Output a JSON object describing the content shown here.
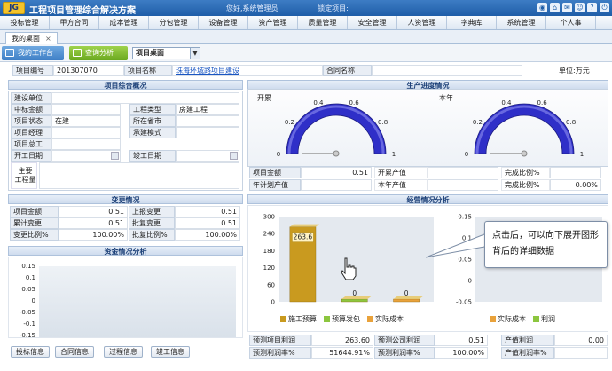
{
  "app": {
    "logo": "JG",
    "title": "工程项目管理综合解决方案",
    "user": "您好,系统管理员",
    "locked_project": "锁定项目:"
  },
  "top_icons": [
    "lock-icon",
    "home-icon",
    "mail-icon",
    "user-icon",
    "help-icon",
    "power-icon"
  ],
  "menu": [
    "投标管理",
    "甲方合同",
    "成本管理",
    "分包管理",
    "设备管理",
    "资产管理",
    "质量管理",
    "安全管理",
    "人资管理",
    "字典库",
    "系统管理",
    "个人事"
  ],
  "tab": {
    "label": "我的桌面",
    "close": "×"
  },
  "toolbar": {
    "btn1": "我的工作台",
    "btn2": "查询分析",
    "select_value": "项目桌面"
  },
  "project": {
    "code_label": "项目编号",
    "code": "201307070",
    "name_label": "项目名称",
    "name": "珠海环城路项目建设",
    "contract_label": "合同名称",
    "contract": "",
    "unit": "单位:万元"
  },
  "overview": {
    "title": "项目综合概况",
    "rows": [
      {
        "l1": "建设单位",
        "v1": "",
        "l2": "",
        "v2": ""
      },
      {
        "l1": "中标金额",
        "v1": "",
        "l2": "工程类型",
        "v2": "房建工程"
      },
      {
        "l1": "项目状态",
        "v1": "在建",
        "l2": "所在省市",
        "v2": ""
      },
      {
        "l1": "项目经理",
        "v1": "",
        "l2": "承建模式",
        "v2": ""
      },
      {
        "l1": "项目总工",
        "v1": "",
        "l2": "",
        "v2": ""
      },
      {
        "l1": "开工日期",
        "v1": "",
        "l2": "竣工日期",
        "v2": ""
      }
    ],
    "main_quantity_label": "主要\n工程量"
  },
  "progress": {
    "title": "生产进度情况",
    "gauge1": {
      "label": "开累",
      "ticks": [
        "0",
        "0.2",
        "0.4",
        "0.6",
        "0.8",
        "1"
      ],
      "value": 0
    },
    "gauge2": {
      "label": "本年",
      "ticks": [
        "0",
        "0.2",
        "0.4",
        "0.6",
        "0.8",
        "1"
      ],
      "value": 0
    },
    "table": [
      {
        "l1": "项目金额",
        "v1": "0.51",
        "l2": "开累产值",
        "v2": "",
        "l3": "完成比例%",
        "v3": ""
      },
      {
        "l1": "年计划产值",
        "v1": "",
        "l2": "本年产值",
        "v2": "",
        "l3": "完成比例%",
        "v3": "0.00%"
      }
    ]
  },
  "change": {
    "title": "变更情况",
    "rows": [
      {
        "l1": "项目金额",
        "v1": "0.51",
        "l2": "上报变更",
        "v2": "0.51"
      },
      {
        "l1": "累计变更",
        "v1": "0.51",
        "l2": "批复变更",
        "v2": "0.51"
      },
      {
        "l1": "变更比例%",
        "v1": "100.00%",
        "l2": "批复比例%",
        "v2": "100.00%"
      }
    ]
  },
  "funds": {
    "title": "资金情况分析",
    "ticks": [
      "0.15",
      "0.1",
      "0.05",
      "0",
      "-0.05",
      "-0.1",
      "-0.15"
    ]
  },
  "operation": {
    "title": "经营情况分析",
    "summary": [
      {
        "l1": "预测项目利润",
        "v1": "263.60",
        "l2": "预测公司利润",
        "v2": "0.51",
        "l3": "产值利润",
        "v3": "0.00"
      },
      {
        "l1": "预测利润率%",
        "v1": "51644.91%",
        "l2": "预测利润率%",
        "v2": "100.00%",
        "l3": "产值利润率%",
        "v3": ""
      }
    ]
  },
  "tooltip": "点击后，可以向下展开图形背后的详细数据",
  "bottom_buttons": [
    "投标信息",
    "合同信息",
    "过程信息",
    "竣工信息"
  ],
  "colors": {
    "bar_gold": "#c99a1f",
    "bar_green": "#8cc63f",
    "bar_orange": "#e9a23b",
    "gauge": "#2f2fc8"
  },
  "chart_data": [
    {
      "type": "bar",
      "title": "",
      "categories": [
        "施工预算",
        "预算发包",
        "实际成本"
      ],
      "values": [
        263.6,
        0,
        0
      ],
      "ylim": [
        0,
        300
      ],
      "yticks": [
        "300",
        "240",
        "180",
        "120",
        "60",
        "0"
      ],
      "data_labels": [
        "263.6",
        "0",
        "0"
      ]
    },
    {
      "type": "bar",
      "title": "",
      "categories": [
        "实际成本",
        "利润"
      ],
      "values": [
        0,
        0
      ],
      "ylim": [
        -0.15,
        0.15
      ],
      "yticks": [
        "0.15",
        "0.1",
        "0.05",
        "0",
        "-0.05"
      ],
      "data_labels": [
        "0",
        "0"
      ]
    }
  ]
}
